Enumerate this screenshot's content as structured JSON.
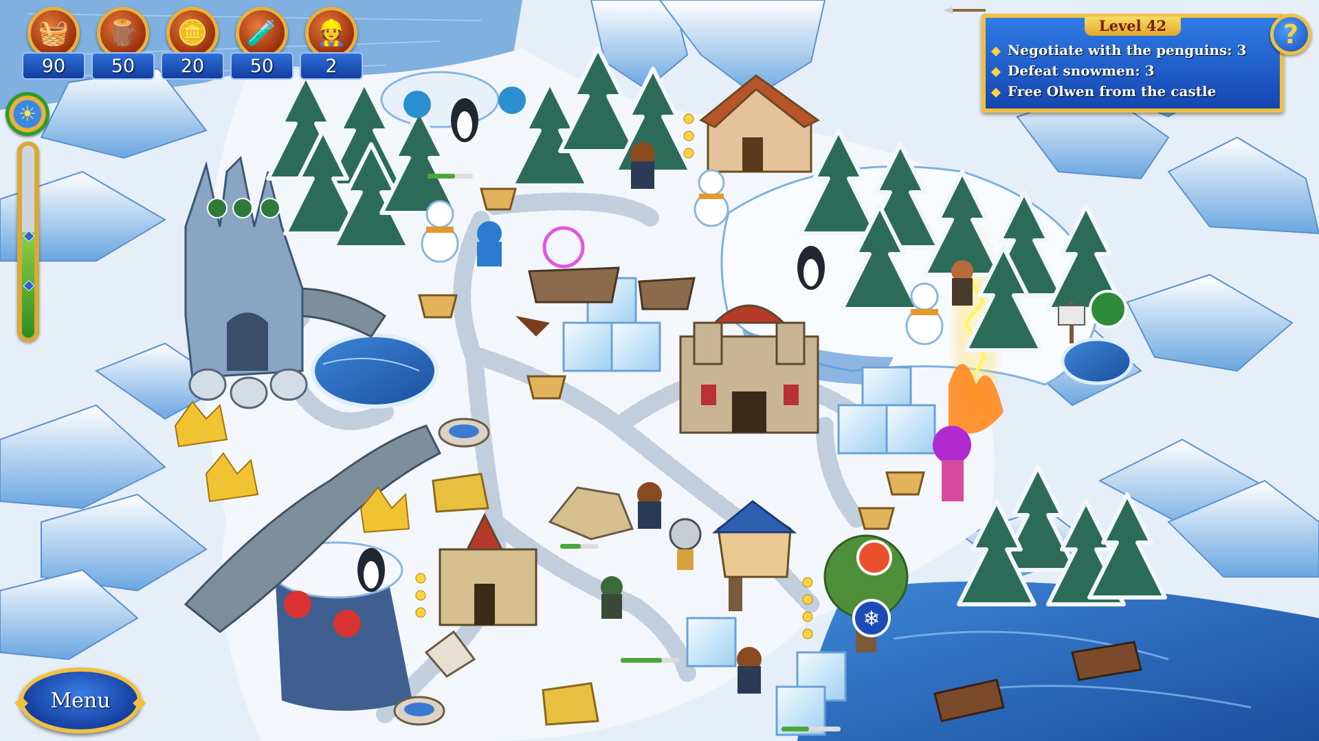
{
  "resources": [
    {
      "name": "food",
      "icon": "food-basket-icon",
      "value": "90"
    },
    {
      "name": "wood",
      "icon": "wood-logs-icon",
      "value": "50"
    },
    {
      "name": "gold",
      "icon": "gold-coins-icon",
      "value": "20"
    },
    {
      "name": "mana",
      "icon": "mana-potion-icon",
      "value": "50"
    },
    {
      "name": "workers",
      "icon": "worker-icon",
      "value": "2"
    }
  ],
  "timer": {
    "remaining_fraction": 0.55
  },
  "objectives": {
    "level": "Level 42",
    "tasks": [
      "Negotiate with the penguins: 3",
      "Defeat snowmen: 3",
      "Free Olwen from the castle"
    ],
    "help_label": "?"
  },
  "menu": {
    "label": "Menu"
  },
  "colors": {
    "panel_blue": "#1f5fd0",
    "gold_trim": "#f0c040",
    "snow": "#eef4fb",
    "ice": "#7fb9ea"
  }
}
